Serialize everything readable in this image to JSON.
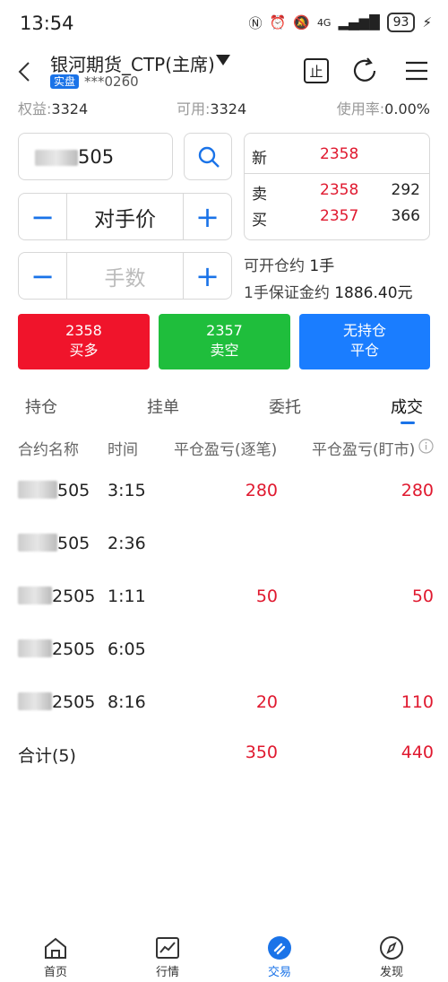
{
  "status": {
    "time": "13:54",
    "battery": "93",
    "net": "4G"
  },
  "header": {
    "title": "银河期货_CTP(主席)",
    "badge": "实盘",
    "account": "***0260"
  },
  "metrics": {
    "equity_label": "权益:",
    "equity": "3324",
    "available_label": "可用:",
    "available": "3324",
    "usage_label": "使用率:",
    "usage": "0.00%"
  },
  "order": {
    "contract_suffix": "505",
    "price_type": "对手价",
    "qty_placeholder": "手数",
    "minus": "−",
    "plus": "+"
  },
  "quote": {
    "last_label": "新",
    "last": "2358",
    "ask_label": "卖",
    "ask": "2358",
    "ask_vol": "292",
    "bid_label": "买",
    "bid": "2357",
    "bid_vol": "366"
  },
  "info": {
    "openable_label": "可开仓约",
    "openable": "1手",
    "margin_label": "1手保证金约",
    "margin": "1886.40元"
  },
  "actions": {
    "buy_price": "2358",
    "buy_label": "买多",
    "sell_price": "2357",
    "sell_label": "卖空",
    "close_top": "无持仓",
    "close_label": "平仓"
  },
  "tabs": [
    "持仓",
    "挂单",
    "委托",
    "成交"
  ],
  "table": {
    "headers": [
      "合约名称",
      "时间",
      "平仓盈亏(逐笔)",
      "平仓盈亏(盯市)"
    ],
    "rows": [
      {
        "contract": "505",
        "time": "3:15",
        "pnl_trade": "280",
        "pnl_mtm": "280"
      },
      {
        "contract": "505",
        "time": "2:36",
        "pnl_trade": "",
        "pnl_mtm": ""
      },
      {
        "contract": "2505",
        "time": "1:11",
        "pnl_trade": "50",
        "pnl_mtm": "50"
      },
      {
        "contract": "2505",
        "time": "6:05",
        "pnl_trade": "",
        "pnl_mtm": ""
      },
      {
        "contract": "2505",
        "time": "8:16",
        "pnl_trade": "20",
        "pnl_mtm": "110"
      }
    ],
    "total": {
      "label": "合计(5)",
      "pnl_trade": "350",
      "pnl_mtm": "440"
    }
  },
  "nav": [
    "首页",
    "行情",
    "交易",
    "发现"
  ],
  "colors": {
    "accent": "#1a73e8",
    "up": "#e0192f",
    "buy": "#f0142b",
    "sell": "#1fbe3c",
    "close": "#1a7dff"
  }
}
